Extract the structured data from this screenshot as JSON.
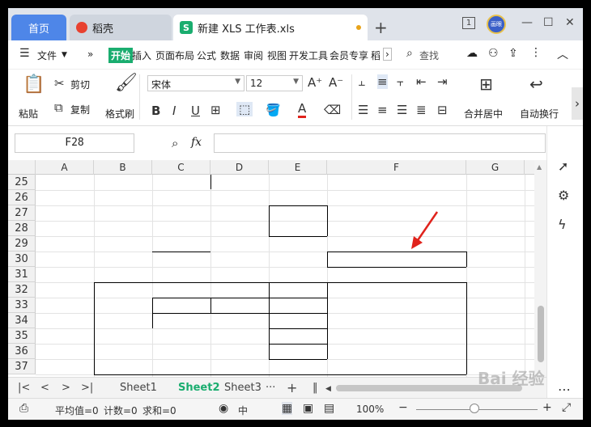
{
  "tabs": {
    "home": "首页",
    "daoke": "稻壳",
    "doc": "新建 XLS 工作表.xls",
    "new": "+"
  },
  "window": {
    "badge": "1",
    "avatar": "画眼",
    "minimize": "—",
    "maximize": "☐",
    "close": "✕"
  },
  "menu": {
    "file": "文件",
    "kaishi": "开始",
    "items": [
      "插入",
      "页面布局",
      "公式",
      "数据",
      "审阅",
      "视图",
      "开发工具",
      "会员专享",
      "稻"
    ],
    "search": "查找"
  },
  "toolbar": {
    "paste": "粘贴",
    "cut": "剪切",
    "copy": "复制",
    "format_painter": "格式刷",
    "font_name": "宋体",
    "font_size": "12",
    "bold": "B",
    "italic": "I",
    "underline": "U",
    "font_color_letter": "A",
    "grow_font": "A⁺",
    "shrink_font": "A⁻",
    "merge_center": "合并居中",
    "wrap_text": "自动换行"
  },
  "formula": {
    "cell_ref": "F28",
    "fx": "fx",
    "value": ""
  },
  "grid": {
    "columns": [
      "A",
      "B",
      "C",
      "D",
      "E",
      "F",
      "G"
    ],
    "rows": [
      "25",
      "26",
      "27",
      "28",
      "29",
      "30",
      "31",
      "32",
      "33",
      "34",
      "35",
      "36",
      "37"
    ]
  },
  "sheets": [
    "Sheet1",
    "Sheet2",
    "Sheet3"
  ],
  "active_sheet": "Sheet2",
  "status": {
    "average": "平均值=0",
    "count": "计数=0",
    "sum": "求和=0",
    "lang": "中",
    "zoom": "100%"
  },
  "watermark": "Bai 经验",
  "colors": {
    "accent": "#4e86e8",
    "green": "#1aad6f",
    "arrow": "#e0231c"
  }
}
